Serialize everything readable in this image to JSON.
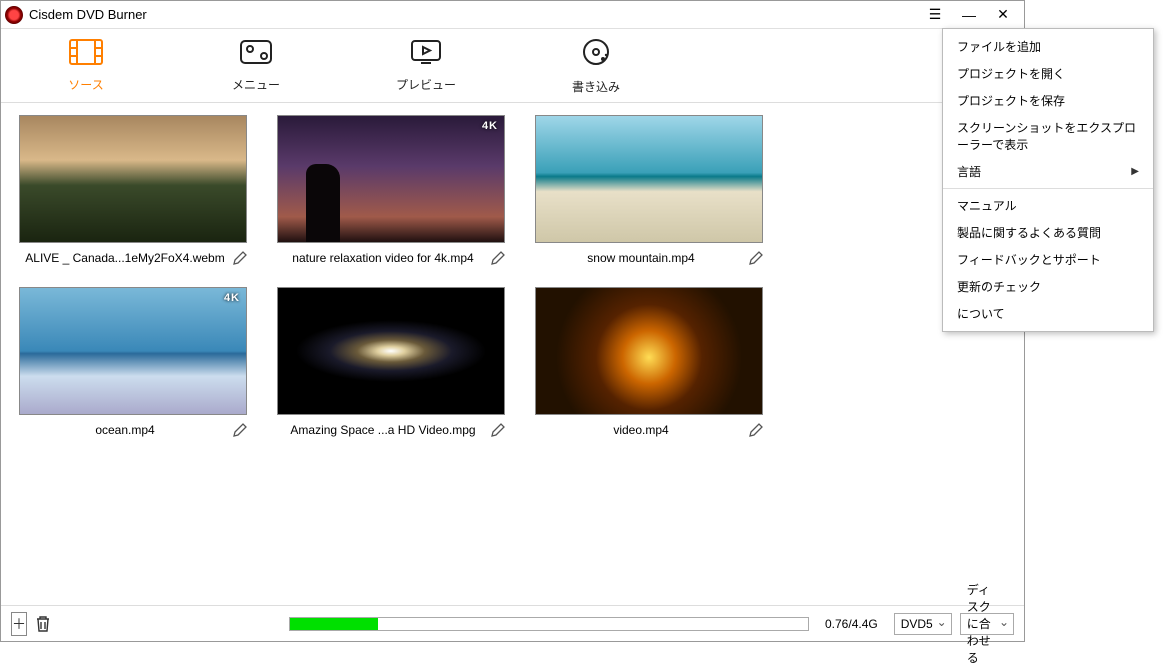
{
  "title": "Cisdem DVD Burner",
  "tabs": [
    {
      "label": "ソース",
      "active": true
    },
    {
      "label": "メニュー",
      "active": false
    },
    {
      "label": "プレビュー",
      "active": false
    },
    {
      "label": "書き込み",
      "active": false
    }
  ],
  "items": [
    {
      "filename": "ALIVE _ Canada...1eMy2FoX4.webm",
      "thumb": "th-mountain",
      "badge": ""
    },
    {
      "filename": "nature relaxation video for 4k.mp4",
      "thumb": "th-night",
      "badge": "4K"
    },
    {
      "filename": "snow mountain.mp4",
      "thumb": "th-beach",
      "badge": ""
    },
    {
      "filename": "ocean.mp4",
      "thumb": "th-ocean",
      "badge": "4K"
    },
    {
      "filename": "Amazing Space ...a HD Video.mpg",
      "thumb": "th-space",
      "badge": ""
    },
    {
      "filename": "video.mp4",
      "thumb": "th-art",
      "badge": ""
    }
  ],
  "bottom": {
    "size_text": "0.76/4.4G",
    "progress_pct": 17,
    "disc_type": "DVD5",
    "fit_mode": "ディスクに合わせる"
  },
  "menu": {
    "items": [
      {
        "label": "ファイルを追加",
        "sub": false
      },
      {
        "label": "プロジェクトを開く",
        "sub": false
      },
      {
        "label": "プロジェクトを保存",
        "sub": false
      },
      {
        "label": "スクリーンショットをエクスプローラーで表示",
        "sub": false
      },
      {
        "label": "言語",
        "sub": true
      },
      {
        "sep": true
      },
      {
        "label": "マニュアル",
        "sub": false
      },
      {
        "label": "製品に関するよくある質問",
        "sub": false
      },
      {
        "label": "フィードバックとサポート",
        "sub": false
      },
      {
        "label": "更新のチェック",
        "sub": false
      },
      {
        "label": "について",
        "sub": false
      }
    ]
  }
}
